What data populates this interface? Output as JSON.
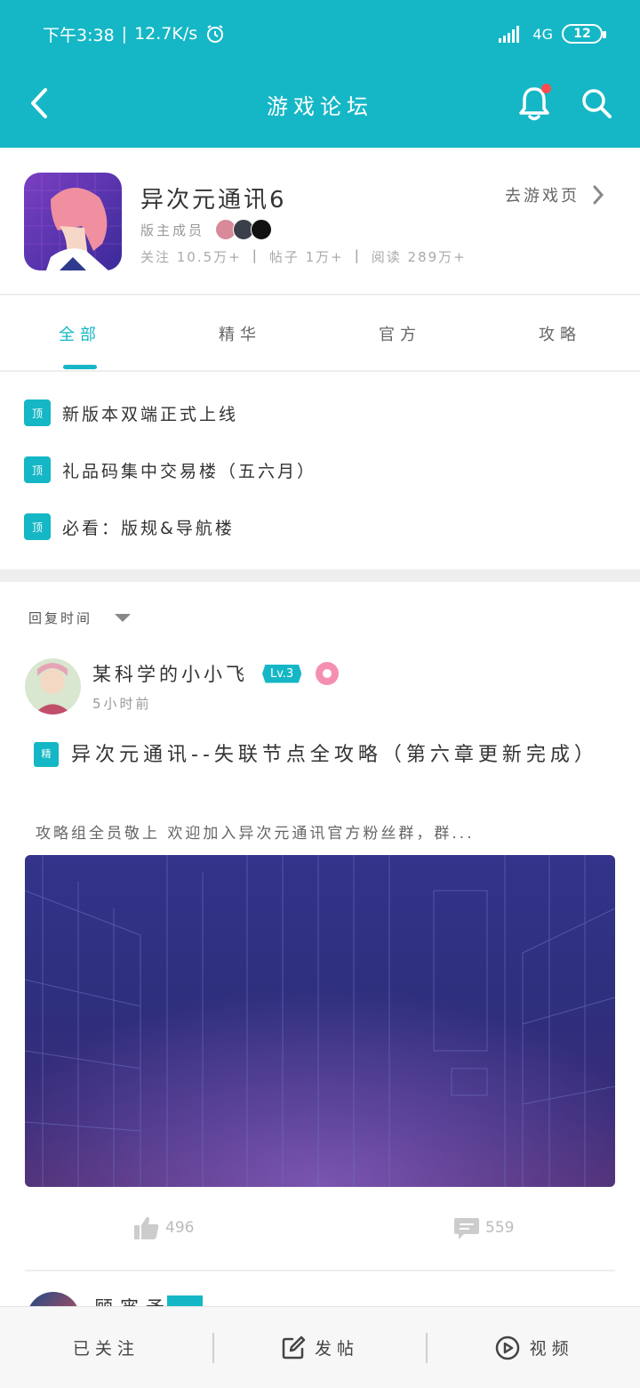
{
  "status_bar": {
    "time": "下午3:38",
    "speed": "12.7K/s",
    "network": "4G",
    "battery": "12"
  },
  "header": {
    "title": "游戏论坛",
    "back_icon": "chevron-left-icon",
    "bell_icon": "bell-icon",
    "search_icon": "search-icon",
    "accent_color": "#15b7c6"
  },
  "game": {
    "name": "异次元通讯6",
    "goto_label": "去游戏页",
    "mods_label": "版主成员",
    "stats": {
      "follow": "关注 10.5万+",
      "posts": "帖子 1万+",
      "reads": "阅读 289万+"
    }
  },
  "tabs": [
    {
      "label": "全部"
    },
    {
      "label": "精华"
    },
    {
      "label": "官方"
    },
    {
      "label": "攻略"
    }
  ],
  "pinned": {
    "badge": "顶",
    "items": [
      "新版本双端正式上线",
      "礼品码集中交易楼（五六月）",
      "必看：版规&导航楼"
    ]
  },
  "sort": {
    "label": "回复时间"
  },
  "post": {
    "username": "某科学的小小飞",
    "level": "Lv.3",
    "time": "5小时前",
    "essence_badge": "精",
    "title": "异次元通讯--失联节点全攻略（第六章更新完成）",
    "excerpt": "攻略组全员敬上 欢迎加入异次元通讯官方粉丝群，群...",
    "likes": "496",
    "comments": "559"
  },
  "next_post": {
    "username": "顾宵予"
  },
  "bottom_bar": {
    "followed": "已关注",
    "post": "发帖",
    "video": "视频"
  }
}
